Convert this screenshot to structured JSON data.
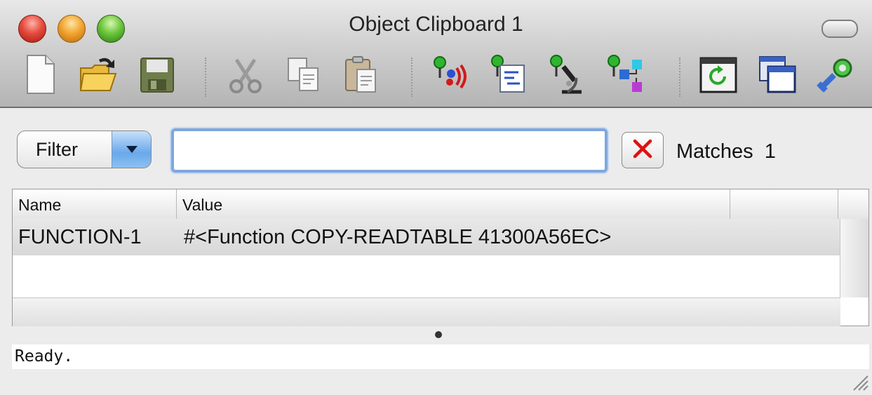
{
  "window": {
    "title": "Object Clipboard 1"
  },
  "toolbar": {
    "buttons": [
      {
        "icon": "new-document-icon"
      },
      {
        "icon": "open-folder-icon"
      },
      {
        "icon": "save-icon"
      },
      {
        "icon": "cut-icon"
      },
      {
        "icon": "copy-icon"
      },
      {
        "icon": "paste-icon"
      },
      {
        "icon": "inspect-icon"
      },
      {
        "icon": "listen-icon"
      },
      {
        "icon": "browse-icon"
      },
      {
        "icon": "class-browser-icon"
      },
      {
        "icon": "refresh-icon"
      },
      {
        "icon": "new-window-icon"
      },
      {
        "icon": "preferences-icon"
      }
    ]
  },
  "filter": {
    "label": "Filter",
    "input_value": "",
    "matches_label": "Matches",
    "matches_count": "1"
  },
  "table": {
    "columns": [
      "Name",
      "Value"
    ],
    "rows": [
      {
        "name": "FUNCTION-1",
        "value": "#<Function COPY-READTABLE 41300A56EC>"
      }
    ]
  },
  "status": {
    "text": "Ready."
  },
  "colors": {
    "close": "#e44b3d",
    "minimize": "#f2a531",
    "zoom": "#6cc63c",
    "focus_ring": "#7fa7dc",
    "clear_x": "#e01010"
  }
}
